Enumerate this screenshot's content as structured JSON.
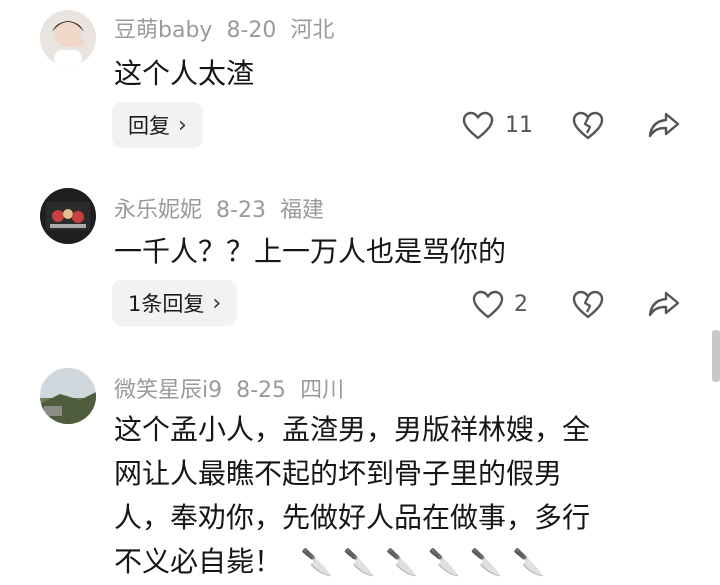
{
  "comments": [
    {
      "username": "豆萌baby",
      "date": "8-20",
      "location": "河北",
      "text": "这个人太渣",
      "reply_label": "回复",
      "like_count": "11"
    },
    {
      "username": "永乐妮妮",
      "date": "8-23",
      "location": "福建",
      "text": "一千人？？上一万人也是骂你的",
      "reply_label": "1条回复",
      "like_count": "2"
    },
    {
      "username": "微笑星辰i9",
      "date": "8-25",
      "location": "四川",
      "lines": [
        "这个孟小人，孟渣男，男版祥林嫂，全",
        "网让人最瞧不起的坏到骨子里的假男",
        "人，奉劝你，先做好人品在做事，多行",
        "不义必自毙！"
      ],
      "emoji": "🔪"
    }
  ]
}
